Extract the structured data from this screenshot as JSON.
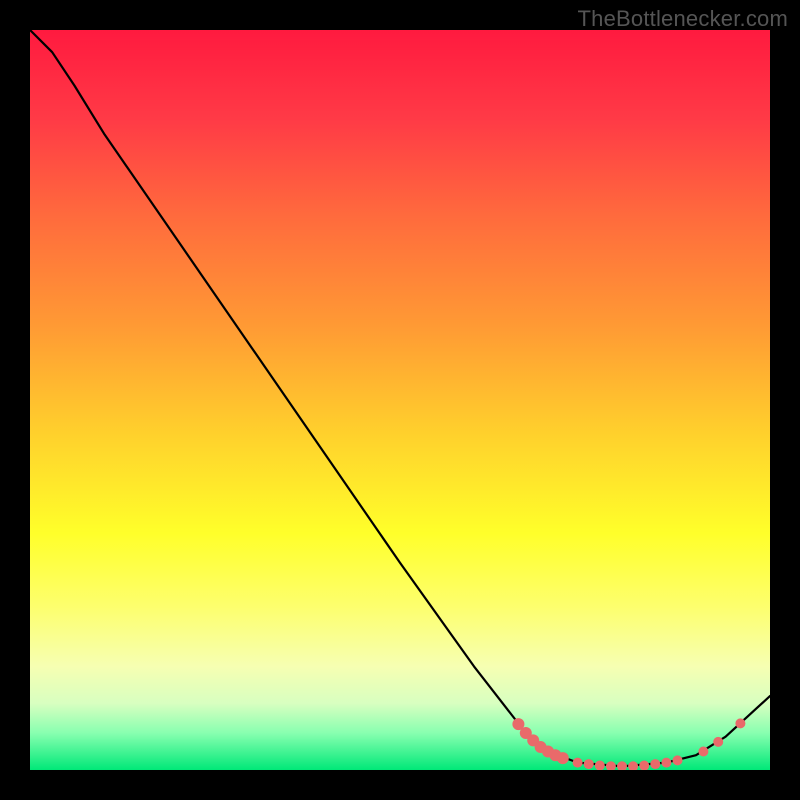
{
  "attribution": "TheBottlenecker.com",
  "chart_data": {
    "type": "line",
    "title": "",
    "xlabel": "",
    "ylabel": "",
    "xlim": [
      0,
      100
    ],
    "ylim": [
      0,
      100
    ],
    "background_gradient": {
      "type": "vertical",
      "stops": [
        {
          "offset": 0.0,
          "color": "#ff1a3f"
        },
        {
          "offset": 0.12,
          "color": "#ff3a46"
        },
        {
          "offset": 0.25,
          "color": "#ff6a3d"
        },
        {
          "offset": 0.4,
          "color": "#ff9a34"
        },
        {
          "offset": 0.55,
          "color": "#ffd22c"
        },
        {
          "offset": 0.68,
          "color": "#ffff2a"
        },
        {
          "offset": 0.78,
          "color": "#fdff6e"
        },
        {
          "offset": 0.86,
          "color": "#f6ffb2"
        },
        {
          "offset": 0.91,
          "color": "#d8ffc0"
        },
        {
          "offset": 0.95,
          "color": "#88ffb0"
        },
        {
          "offset": 1.0,
          "color": "#00e878"
        }
      ]
    },
    "series": [
      {
        "name": "bottleneck-curve",
        "stroke": "#000000",
        "stroke_width": 2.2,
        "points": [
          {
            "x": 0.0,
            "y": 100.0
          },
          {
            "x": 3.0,
            "y": 97.0
          },
          {
            "x": 6.0,
            "y": 92.5
          },
          {
            "x": 10.0,
            "y": 86.0
          },
          {
            "x": 20.0,
            "y": 71.5
          },
          {
            "x": 30.0,
            "y": 57.0
          },
          {
            "x": 40.0,
            "y": 42.5
          },
          {
            "x": 50.0,
            "y": 28.0
          },
          {
            "x": 60.0,
            "y": 14.0
          },
          {
            "x": 67.0,
            "y": 5.0
          },
          {
            "x": 70.0,
            "y": 2.5
          },
          {
            "x": 74.0,
            "y": 1.0
          },
          {
            "x": 80.0,
            "y": 0.5
          },
          {
            "x": 86.0,
            "y": 1.0
          },
          {
            "x": 90.0,
            "y": 2.0
          },
          {
            "x": 94.0,
            "y": 4.5
          },
          {
            "x": 100.0,
            "y": 10.0
          }
        ]
      }
    ],
    "marker_groups": [
      {
        "name": "dense-cluster-left",
        "color": "#e96a6a",
        "radius": 6,
        "points": [
          {
            "x": 66.0,
            "y": 6.2
          },
          {
            "x": 67.0,
            "y": 5.0
          },
          {
            "x": 68.0,
            "y": 4.0
          },
          {
            "x": 69.0,
            "y": 3.1
          },
          {
            "x": 70.0,
            "y": 2.5
          },
          {
            "x": 71.0,
            "y": 2.0
          },
          {
            "x": 72.0,
            "y": 1.6
          }
        ]
      },
      {
        "name": "dense-cluster-bottom",
        "color": "#e96a6a",
        "radius": 5,
        "points": [
          {
            "x": 74.0,
            "y": 1.0
          },
          {
            "x": 75.5,
            "y": 0.8
          },
          {
            "x": 77.0,
            "y": 0.6
          },
          {
            "x": 78.5,
            "y": 0.5
          },
          {
            "x": 80.0,
            "y": 0.5
          },
          {
            "x": 81.5,
            "y": 0.5
          },
          {
            "x": 83.0,
            "y": 0.6
          },
          {
            "x": 84.5,
            "y": 0.8
          },
          {
            "x": 86.0,
            "y": 1.0
          },
          {
            "x": 87.5,
            "y": 1.3
          }
        ]
      },
      {
        "name": "sparse-right",
        "color": "#e96a6a",
        "radius": 5,
        "points": [
          {
            "x": 91.0,
            "y": 2.5
          },
          {
            "x": 93.0,
            "y": 3.8
          },
          {
            "x": 96.0,
            "y": 6.3
          }
        ]
      }
    ]
  }
}
